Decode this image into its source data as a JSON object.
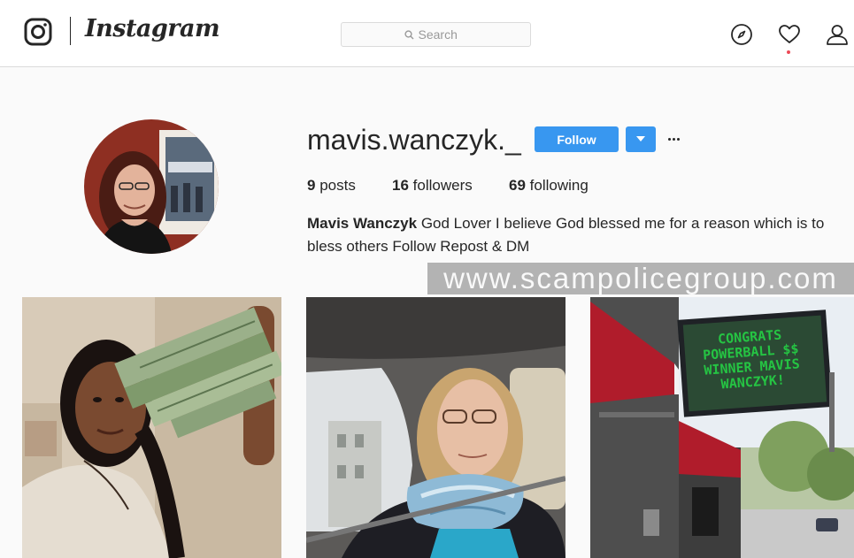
{
  "header": {
    "brand": "Instagram",
    "search_placeholder": "Search",
    "nav_icons": [
      "explore-icon",
      "heart-icon",
      "profile-icon"
    ]
  },
  "profile": {
    "username": "mavis.wanczyk._",
    "follow_label": "Follow",
    "stats": {
      "posts_count": "9",
      "posts_label": "posts",
      "followers_count": "16",
      "followers_label": "followers",
      "following_count": "69",
      "following_label": "following"
    },
    "full_name": "Mavis Wanczyk",
    "bio": "God Lover I believe God blessed me for a reason which is to bless others Follow Repost & DM"
  },
  "watermark": "www.scampolicegroup.com",
  "posts": [
    {
      "image": "woman-with-cash-photo"
    },
    {
      "image": "selfie-in-car-photo"
    },
    {
      "image": "powerball-billboard-photo",
      "billboard_text": "CONGRATS POWERBALL $$ WINNER MAVIS WANCZYK!"
    }
  ],
  "colors": {
    "accent": "#3897f0",
    "text": "#262626",
    "background": "#fafafa",
    "border": "#dbdbdb",
    "notification": "#ed4956"
  }
}
